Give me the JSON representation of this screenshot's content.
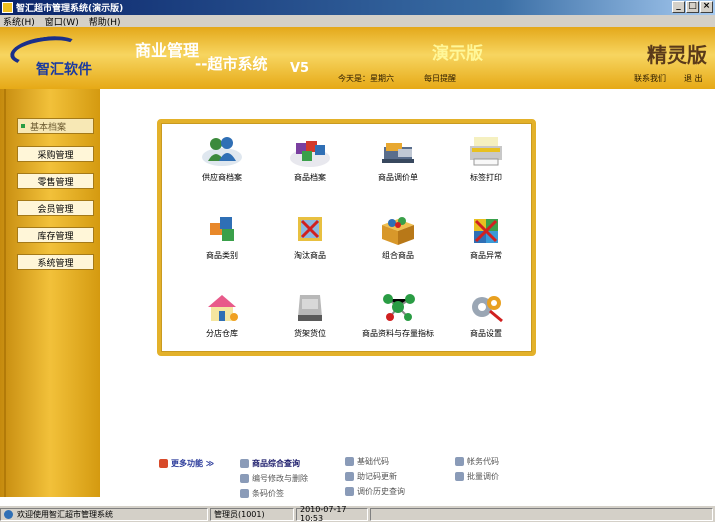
{
  "window": {
    "title": "智汇超市管理系统(演示版)",
    "min": "_",
    "max": "□",
    "close": "×"
  },
  "menu": [
    "系统(H)",
    "窗口(W)",
    "帮助(H)"
  ],
  "header": {
    "logo_text": "智汇软件",
    "product_title": "商业管理",
    "product_sub": "--超市系统",
    "version": "V5",
    "demo_label": "演示版",
    "edition": "精灵版",
    "today": "今天是：星期六",
    "reminder": "每日提醒",
    "contact": "联系我们",
    "exit": "退 出"
  },
  "sidebar": {
    "items": [
      {
        "label": "基本档案",
        "active": true
      },
      {
        "label": "采购管理"
      },
      {
        "label": "零售管理"
      },
      {
        "label": "会员管理"
      },
      {
        "label": "库存管理"
      },
      {
        "label": "系统管理"
      }
    ]
  },
  "tiles": [
    {
      "label": "供应商档案",
      "icon": "people-icon"
    },
    {
      "label": "商品档案",
      "icon": "boxes-icon"
    },
    {
      "label": "商品调价单",
      "icon": "price-adjust-icon"
    },
    {
      "label": "标签打印",
      "icon": "printer-icon"
    },
    {
      "label": "商品类别",
      "icon": "category-cubes-icon"
    },
    {
      "label": "淘汰商品",
      "icon": "obsolete-goods-icon"
    },
    {
      "label": "组合商品",
      "icon": "combo-box-icon"
    },
    {
      "label": "商品异常",
      "icon": "goods-error-icon"
    },
    {
      "label": "分店仓库",
      "icon": "house-icon"
    },
    {
      "label": "货架货位",
      "icon": "shelf-icon"
    },
    {
      "label": "商品资料与存量指标",
      "icon": "molecule-icon"
    },
    {
      "label": "商品设置",
      "icon": "settings-gears-icon"
    }
  ],
  "quick_links": {
    "more": "更多功能 ≫",
    "col1": [
      "商品综合查询",
      "编号修改与删除",
      "条码价签"
    ],
    "col2": [
      "基础代码",
      "助记码更新",
      "调价历史查询"
    ],
    "col3": [
      "帐务代码",
      "批量调价"
    ]
  },
  "status": {
    "welcome": "欢迎使用智汇超市管理系统",
    "user": "管理员(1001)",
    "datetime": "2010-07-17 10:53"
  }
}
